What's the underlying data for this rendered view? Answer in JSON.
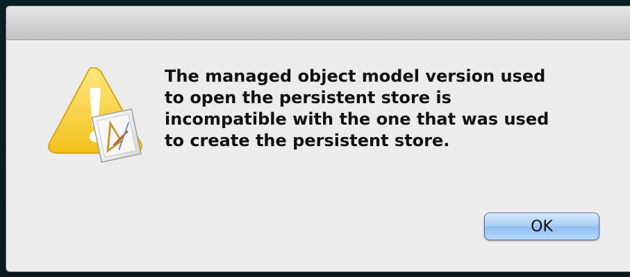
{
  "dialog": {
    "message": "The managed object model version used\nto open the persistent store is\nincompatible with the one that was used\nto create the persistent store.",
    "icon": "warning-icon",
    "ok_label": "OK",
    "accent_color": "#a9cdf5"
  }
}
